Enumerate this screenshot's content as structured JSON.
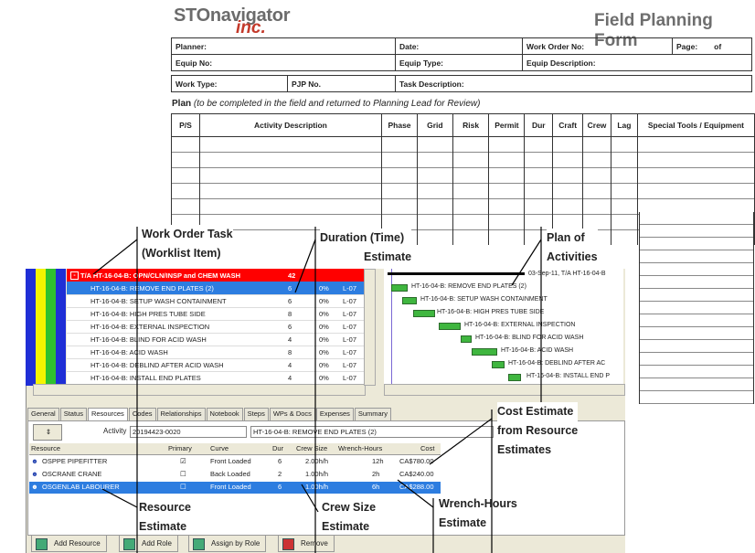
{
  "form": {
    "logo_main": "STOnavigator",
    "logo_inc": "inc.",
    "title": "Field Planning Form",
    "row1": [
      "Planner:",
      "Date:",
      "Work Order No:",
      "Page:",
      "of"
    ],
    "row2": [
      "Equip No:",
      "Equip Type:",
      "Equip Description:"
    ],
    "row3": [
      "Work Type:",
      "PJP No.",
      "Task Description:"
    ],
    "plan_bold": "Plan",
    "plan_note": "(to be completed in the field and returned to Planning Lead for Review)",
    "columns": [
      "P/S",
      "Activity Description",
      "Phase",
      "Grid",
      "Risk",
      "Permit",
      "Dur",
      "Craft",
      "Crew",
      "Lag",
      "Special Tools / Equipment"
    ]
  },
  "grid": {
    "summary": {
      "name": "T/A HT-16-04-B: OPN/CLN/INSP and CHEM WASH",
      "dur": "42"
    },
    "rows": [
      {
        "name": "HT-16-04-B: REMOVE END PLATES (2)",
        "dur": "6",
        "pct": "0%",
        "lbl": "L-07"
      },
      {
        "name": "HT-16-04-B: SETUP WASH CONTAINMENT",
        "dur": "6",
        "pct": "0%",
        "lbl": "L-07"
      },
      {
        "name": "HT-16-04-B: HIGH PRES TUBE SIDE",
        "dur": "8",
        "pct": "0%",
        "lbl": "L-07"
      },
      {
        "name": "HT-16-04-B: EXTERNAL  INSPECTION",
        "dur": "6",
        "pct": "0%",
        "lbl": "L-07"
      },
      {
        "name": "HT-16-04-B: BLIND FOR ACID WASH",
        "dur": "4",
        "pct": "0%",
        "lbl": "L-07"
      },
      {
        "name": "HT-16-04-B: ACID WASH",
        "dur": "8",
        "pct": "0%",
        "lbl": "L-07"
      },
      {
        "name": "HT-16-04-B: DEBLIND AFTER ACID WASH",
        "dur": "4",
        "pct": "0%",
        "lbl": "L-07"
      },
      {
        "name": "HT-16-04-B: INSTALL END PLATES",
        "dur": "4",
        "pct": "0%",
        "lbl": "L-07"
      }
    ]
  },
  "gantt": {
    "summary_label": "03-Sep-11, T/A HT-16-04-B",
    "labels": [
      "HT-16-04-B: REMOVE END PLATES (2)",
      "HT-16-04-B: SETUP WASH CONTAINMENT",
      "HT-16-04-B: HIGH PRES TUBE SIDE",
      "HT-16-04-B: EXTERNAL  INSPECTION",
      "HT-16-04-B: BLIND FOR ACID WASH",
      "HT-16-04-B: ACID WASH",
      "HT-16-04-B: DEBLIND AFTER AC",
      "HT-16-04-B: INSTALL END P"
    ]
  },
  "tabs": [
    "General",
    "Status",
    "Resources",
    "Codes",
    "Relationships",
    "Notebook",
    "Steps",
    "WPs & Docs",
    "Expenses",
    "Summary"
  ],
  "activity": {
    "label": "Activity",
    "id": "20194423-0020",
    "name": "HT-16-04-B: REMOVE END PLATES (2)"
  },
  "resources": {
    "headers": [
      "Resource",
      "Primary",
      "Curve",
      "Dur",
      "Crew Size",
      "Wrench-Hours",
      "Cost"
    ],
    "rows": [
      {
        "name": "OSPPE PIPEFITTER",
        "primary": "☑",
        "curve": "Front Loaded",
        "dur": "6",
        "crew": "2.00h/h",
        "hours": "12h",
        "cost": "CA$780.00"
      },
      {
        "name": "OSCRANE CRANE",
        "primary": "☐",
        "curve": "Back Loaded",
        "dur": "2",
        "crew": "1.00h/h",
        "hours": "2h",
        "cost": "CA$240.00"
      },
      {
        "name": "OSGENLAB LABOURER",
        "primary": "☐",
        "curve": "Front Loaded",
        "dur": "6",
        "crew": "1.00h/h",
        "hours": "6h",
        "cost": "CA$288.00"
      }
    ]
  },
  "buttons": [
    "Add Resource",
    "Add Role",
    "Assign by Role",
    "Remove"
  ],
  "annotations": {
    "work_order_task": [
      "Work Order Task",
      "(Worklist Item)"
    ],
    "duration": [
      "Duration (Time)",
      "Estimate"
    ],
    "plan_of_activities": [
      "Plan of",
      "Activities"
    ],
    "cost_estimate": [
      "Cost Estimate",
      "from Resource",
      "Estimates"
    ],
    "resource_estimate": [
      "Resource",
      "Estimate"
    ],
    "crew_size": [
      "Crew Size",
      "Estimate"
    ],
    "wrench_hours": [
      "Wrench-Hours",
      "Estimate"
    ]
  },
  "colors": {
    "summary_row": "#ff0000",
    "selected_row": "#2d7de0",
    "gantt_bar": "#3fb63f",
    "annotation_text": "#000000",
    "logo_accent": "#c43a2b"
  }
}
